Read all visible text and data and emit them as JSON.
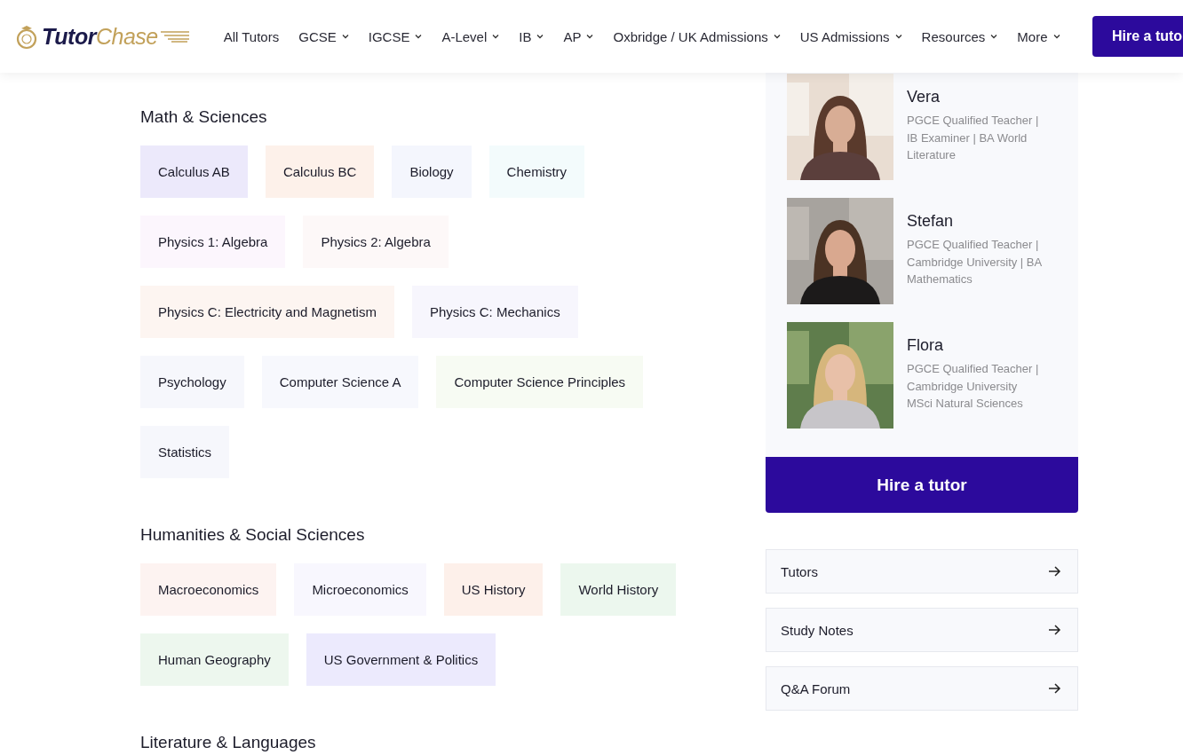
{
  "header": {
    "logo": {
      "dark_part": "Tutor",
      "gold_part": "Chase"
    },
    "nav": [
      {
        "label": "All Tutors",
        "has_dropdown": false
      },
      {
        "label": "GCSE",
        "has_dropdown": true
      },
      {
        "label": "IGCSE",
        "has_dropdown": true
      },
      {
        "label": "A-Level",
        "has_dropdown": true
      },
      {
        "label": "IB",
        "has_dropdown": true
      },
      {
        "label": "AP",
        "has_dropdown": true
      },
      {
        "label": "Oxbridge / UK Admissions",
        "has_dropdown": true
      },
      {
        "label": "US Admissions",
        "has_dropdown": true
      },
      {
        "label": "Resources",
        "has_dropdown": true
      },
      {
        "label": "More",
        "has_dropdown": true
      }
    ],
    "cta": "Hire a tuto"
  },
  "sections": [
    {
      "title": "Math & Sciences",
      "subjects": [
        {
          "label": "Calculus AB",
          "color": "#ece9fb"
        },
        {
          "label": "Calculus BC",
          "color": "#fdf1ea"
        },
        {
          "label": "Biology",
          "color": "#f4f6fd"
        },
        {
          "label": "Chemistry",
          "color": "#f3fbfc"
        },
        {
          "label": "Physics 1: Algebra",
          "color": "#fcf6fd"
        },
        {
          "label": "Physics 2: Algebra",
          "color": "#fdf8f8"
        },
        {
          "label": "Physics C: Electricity and Magnetism",
          "color": "#fdf5f1"
        },
        {
          "label": "Physics C: Mechanics",
          "color": "#f7f6fd"
        },
        {
          "label": "Psychology",
          "color": "#f6f7fc"
        },
        {
          "label": "Computer Science A",
          "color": "#f7f8fd"
        },
        {
          "label": "Computer Science Principles",
          "color": "#f7fbf3"
        },
        {
          "label": "Statistics",
          "color": "#f6f7fc"
        }
      ]
    },
    {
      "title": "Humanities & Social Sciences",
      "subjects": [
        {
          "label": "Macroeconomics",
          "color": "#fdf3f1"
        },
        {
          "label": "Microeconomics",
          "color": "#f8f7fe"
        },
        {
          "label": "US History",
          "color": "#fdf0ea"
        },
        {
          "label": "World History",
          "color": "#ecf7ee"
        },
        {
          "label": "Human Geography",
          "color": "#edf7ee"
        },
        {
          "label": "US Government & Politics",
          "color": "#eceafd"
        }
      ]
    },
    {
      "title": "Literature & Languages"
    }
  ],
  "sidebar": {
    "tutors": [
      {
        "name": "Vera",
        "description": "PGCE Qualified Teacher | IB Examiner | BA World Literature"
      },
      {
        "name": "Stefan",
        "description": "PGCE Qualified Teacher | Cambridge University | BA Mathematics"
      },
      {
        "name": "Flora",
        "description": "PGCE Qualified Teacher | Cambridge University MSci Natural Sciences"
      }
    ],
    "cta": "Hire a tutor",
    "links": [
      {
        "label": "Tutors"
      },
      {
        "label": "Study Notes"
      },
      {
        "label": "Q&A Forum"
      }
    ]
  }
}
